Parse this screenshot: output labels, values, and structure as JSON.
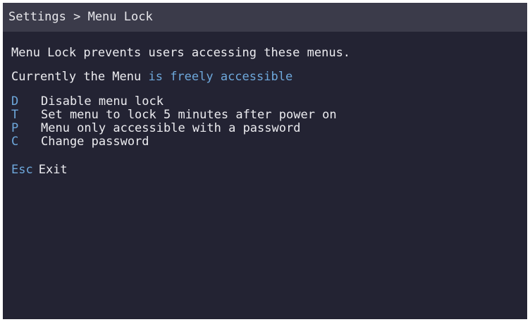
{
  "window": {
    "breadcrumb": "Settings > Menu Lock"
  },
  "main": {
    "description": "Menu Lock prevents users accessing these menus.",
    "status_prefix": "Currently the Menu",
    "status_value": "is freely accessible",
    "options": [
      {
        "key": "D",
        "label": "Disable menu lock"
      },
      {
        "key": "T",
        "label": "Set menu to lock 5 minutes after power on"
      },
      {
        "key": "P",
        "label": "Menu only accessible with a password"
      },
      {
        "key": "C",
        "label": "Change password"
      }
    ],
    "exit": {
      "key": "Esc",
      "label": "Exit"
    }
  },
  "colors": {
    "background": "#232333",
    "title_bar": "#3b3b4a",
    "text": "#ececf0",
    "accent": "#6ea8dc"
  }
}
